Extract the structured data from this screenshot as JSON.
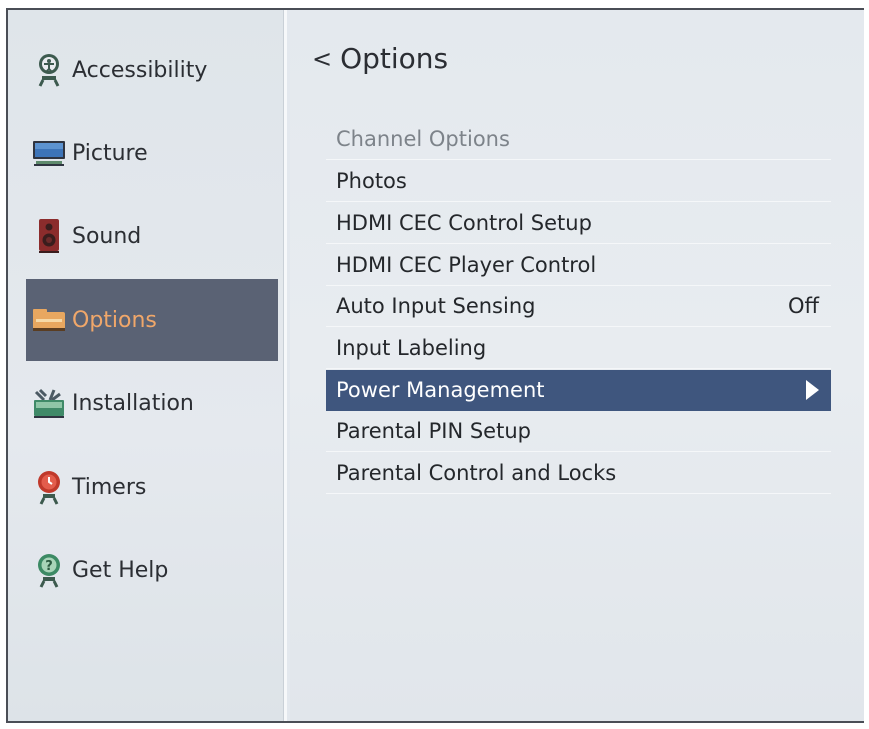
{
  "sidebar": {
    "items": [
      {
        "label": "Accessibility",
        "icon": "accessibility-icon"
      },
      {
        "label": "Picture",
        "icon": "picture-icon"
      },
      {
        "label": "Sound",
        "icon": "sound-icon"
      },
      {
        "label": "Options",
        "icon": "options-icon",
        "selected": true
      },
      {
        "label": "Installation",
        "icon": "installation-icon"
      },
      {
        "label": "Timers",
        "icon": "timers-icon"
      },
      {
        "label": "Get Help",
        "icon": "get-help-icon"
      }
    ]
  },
  "main": {
    "back_chevron": "<",
    "title": "Options",
    "menu": [
      {
        "label": "Channel Options",
        "value": "",
        "dimmed": true
      },
      {
        "label": "Photos",
        "value": ""
      },
      {
        "label": "HDMI CEC Control Setup",
        "value": ""
      },
      {
        "label": "HDMI CEC Player Control",
        "value": ""
      },
      {
        "label": "Auto Input Sensing",
        "value": "Off"
      },
      {
        "label": "Input Labeling",
        "value": ""
      },
      {
        "label": "Power Management",
        "value": "",
        "selected": true
      },
      {
        "label": "Parental PIN Setup",
        "value": ""
      },
      {
        "label": "Parental Control and Locks",
        "value": ""
      }
    ]
  },
  "colors": {
    "sidebar_selected_bg": "#5a6274",
    "sidebar_selected_text": "#f0a76a",
    "menu_selected_bg": "#3f567e"
  }
}
